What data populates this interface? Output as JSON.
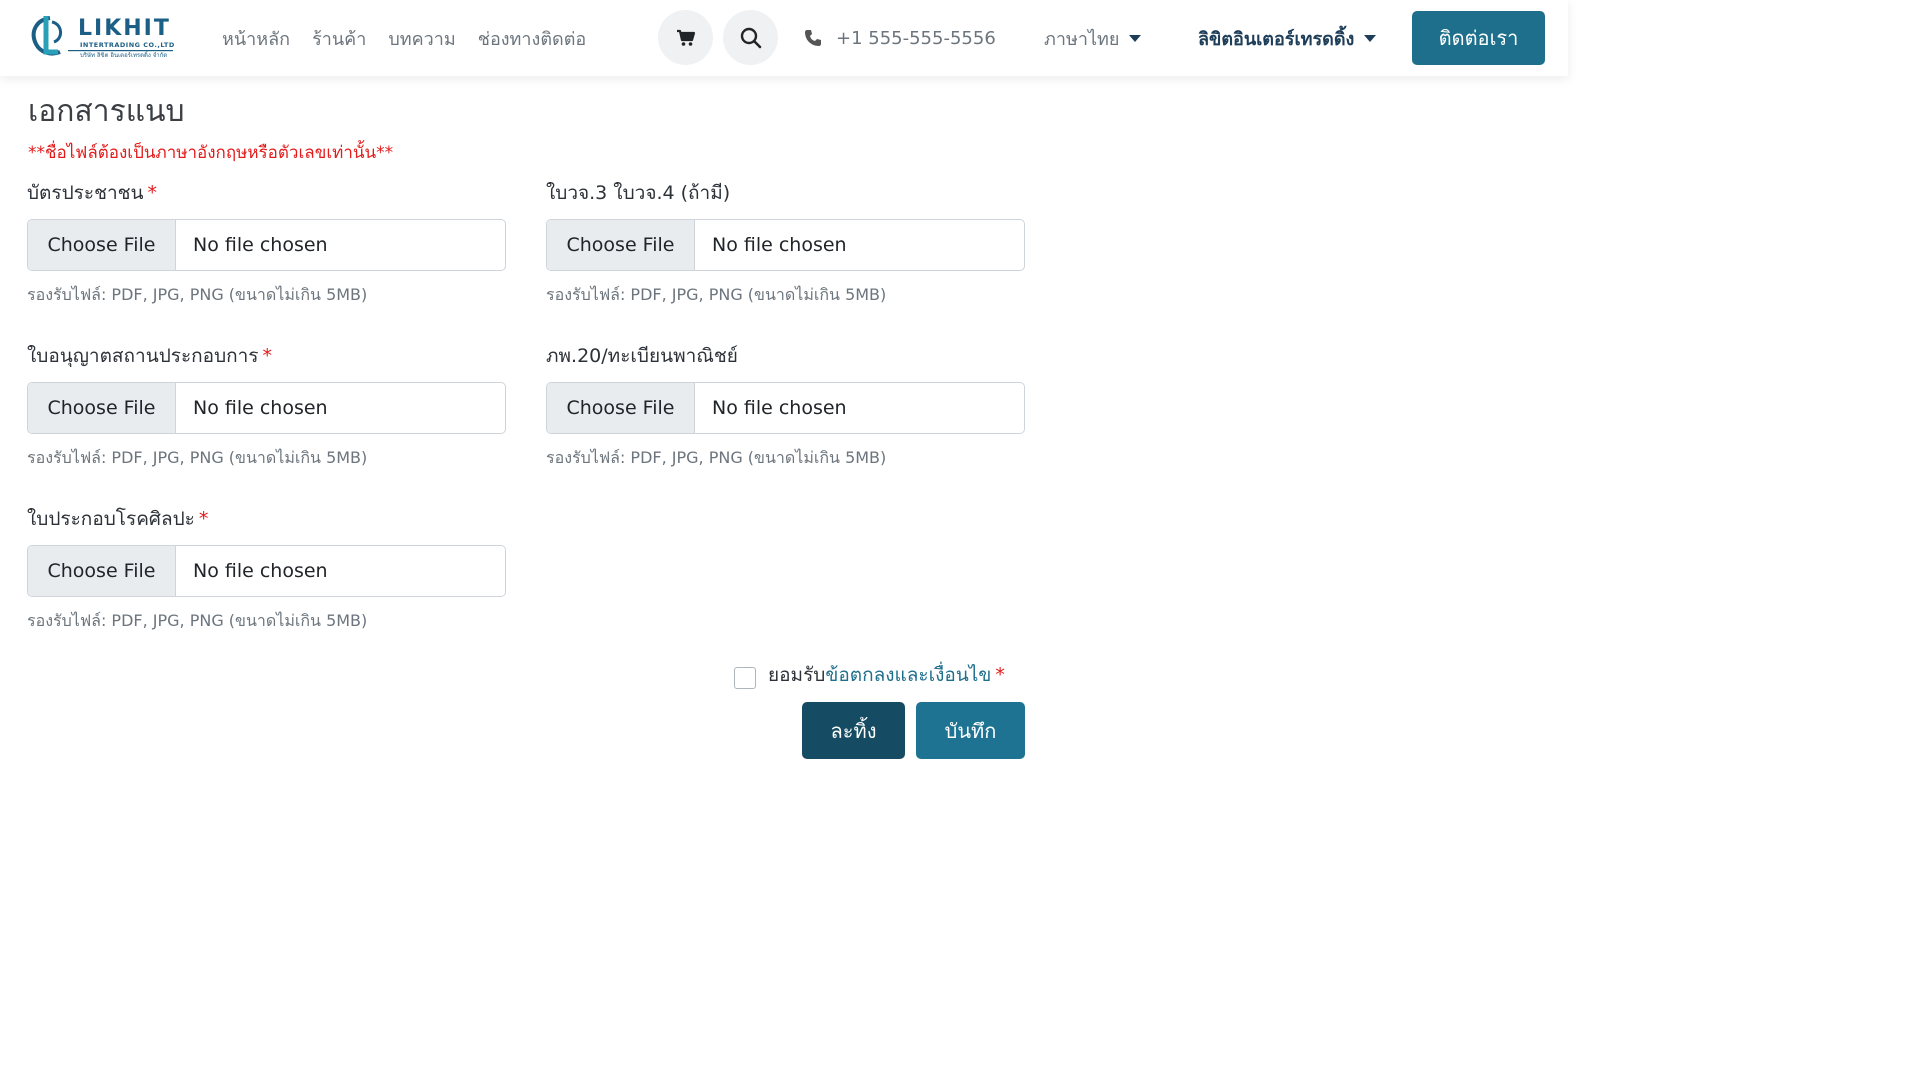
{
  "header": {
    "logo": {
      "word": "LIKHIT",
      "sub_en": "INTERTRADING CO.,LTD",
      "sub_th": "บริษัท ลิขิต อินเตอร์เทรดดิ้ง จำกัด"
    },
    "nav": [
      {
        "label": "หน้าหลัก"
      },
      {
        "label": "ร้านค้า"
      },
      {
        "label": "บทความ"
      },
      {
        "label": "ช่องทางติดต่อ"
      }
    ],
    "phone": "+1 555-555-5556",
    "language": "ภาษาไทย",
    "company": "ลิขิตอินเตอร์เทรดดิ้ง",
    "contact_button": "ติดต่อเรา"
  },
  "section": {
    "title": "เอกสารแนบ",
    "warning": "**ชื่อไฟล์ต้องเป็นภาษาอังกฤษหรือตัวเลขเท่านั้น**"
  },
  "fields": [
    {
      "label": "บัตรประชาชน",
      "required": "*",
      "button": "Choose File",
      "value": "No file chosen",
      "help": "รองรับไฟล์: PDF, JPG, PNG (ขนาดไม่เกิน 5MB)"
    },
    {
      "label": "ใบวจ.3 ใบวจ.4 (ถ้ามี)",
      "required": "",
      "button": "Choose File",
      "value": "No file chosen",
      "help": "รองรับไฟล์: PDF, JPG, PNG (ขนาดไม่เกิน 5MB)"
    },
    {
      "label": "ใบอนุญาตสถานประกอบการ",
      "required": "*",
      "button": "Choose File",
      "value": "No file chosen",
      "help": "รองรับไฟล์: PDF, JPG, PNG (ขนาดไม่เกิน 5MB)"
    },
    {
      "label": "ภพ.20/ทะเบียนพาณิชย์",
      "required": "",
      "button": "Choose File",
      "value": "No file chosen",
      "help": "รองรับไฟล์: PDF, JPG, PNG (ขนาดไม่เกิน 5MB)"
    },
    {
      "label": "ใบประกอบโรคศิลปะ",
      "required": "*",
      "button": "Choose File",
      "value": "No file chosen",
      "help": "รองรับไฟล์: PDF, JPG, PNG (ขนาดไม่เกิน 5MB)"
    }
  ],
  "agree": {
    "prefix": "ยอมรับ",
    "link": "ข้อตกลงและเงื่อนไข",
    "required": "*",
    "checked": false
  },
  "actions": {
    "cancel": "ละทิ้ง",
    "save": "บันทึก"
  },
  "colors": {
    "primary": "#1e7392",
    "primary_dark": "#164c63",
    "required": "#e31b1b",
    "brand": "#1b5f86"
  }
}
